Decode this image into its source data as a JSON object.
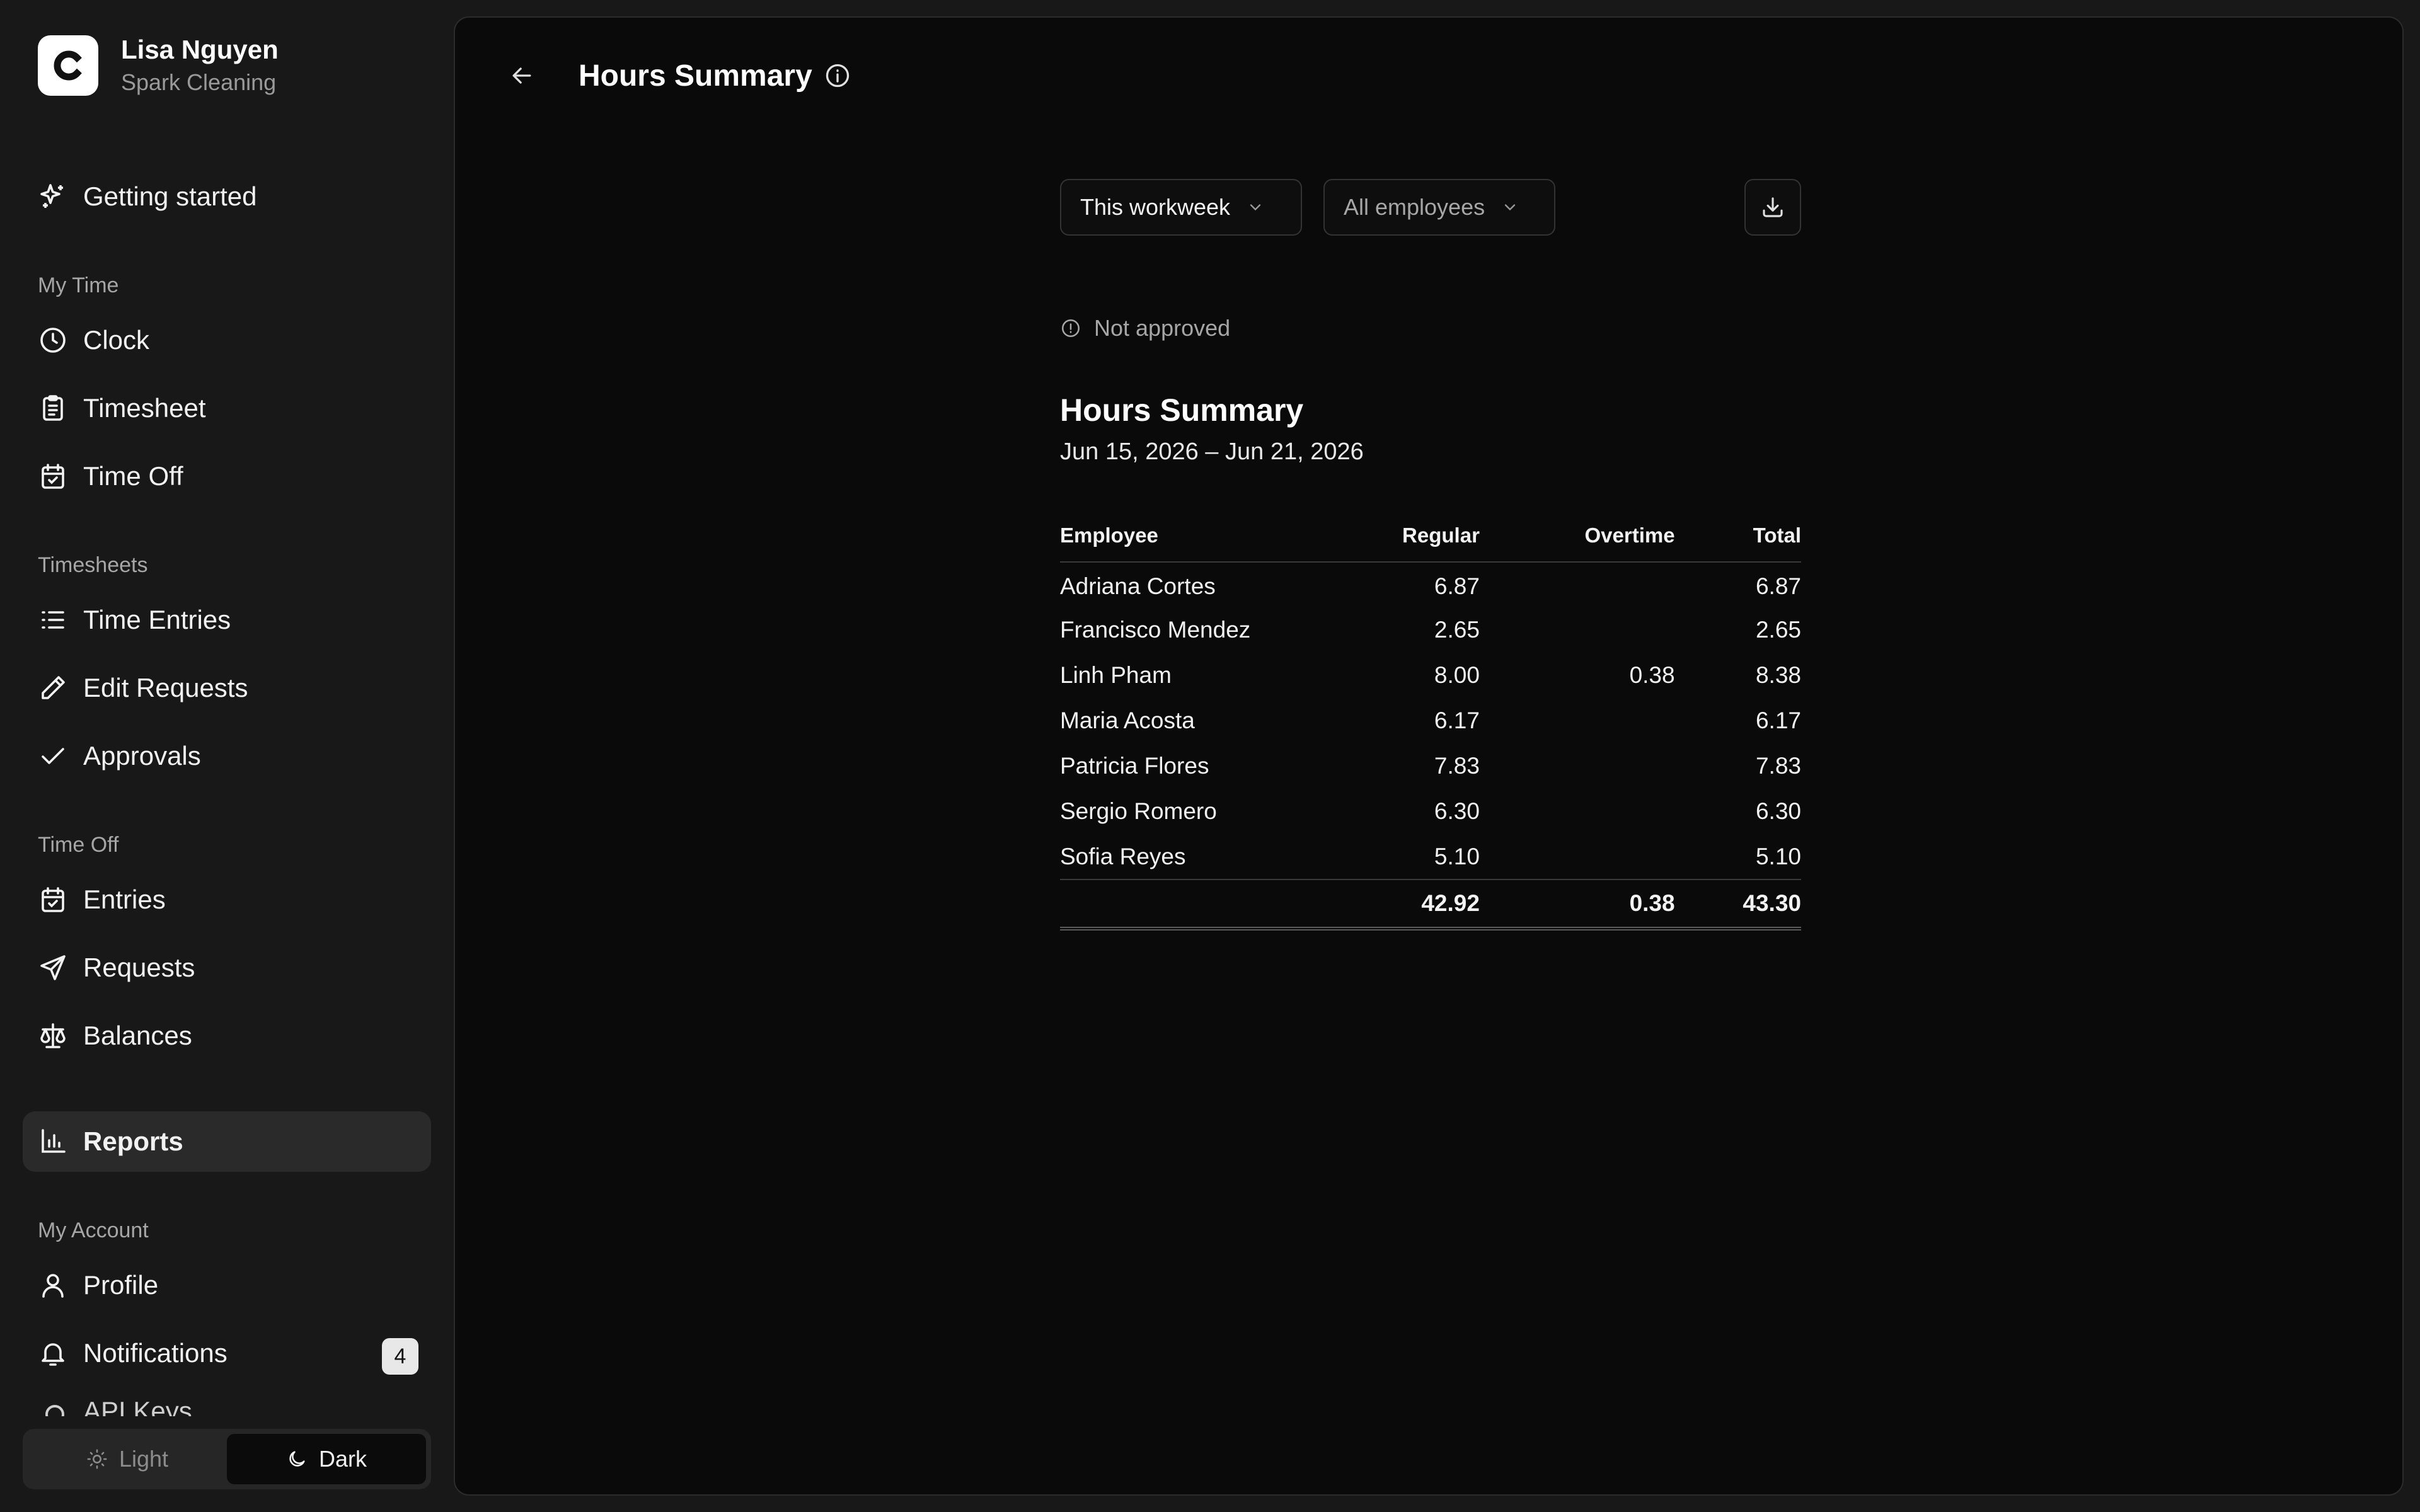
{
  "user": {
    "name": "Lisa Nguyen",
    "company": "Spark Cleaning",
    "logo_letter": "C"
  },
  "nav": {
    "getting_started": "Getting started",
    "my_time": {
      "label": "My Time",
      "items": [
        "Clock",
        "Timesheet",
        "Time Off"
      ]
    },
    "timesheets": {
      "label": "Timesheets",
      "items": [
        "Time Entries",
        "Edit Requests",
        "Approvals"
      ]
    },
    "time_off": {
      "label": "Time Off",
      "items": [
        "Entries",
        "Requests",
        "Balances"
      ]
    },
    "reports": "Reports",
    "my_account": {
      "label": "My Account",
      "items": [
        "Profile",
        "Notifications"
      ]
    },
    "notifications_count": "4",
    "clipped_item": "API Keys"
  },
  "theme": {
    "light": "Light",
    "dark": "Dark",
    "selected": "Dark"
  },
  "page": {
    "title": "Hours Summary"
  },
  "filters": {
    "period": "This workweek",
    "employees": "All employees"
  },
  "status": "Not approved",
  "report": {
    "title": "Hours Summary",
    "range": "Jun 15, 2026 – Jun 21, 2026",
    "columns": [
      "Employee",
      "Regular",
      "Overtime",
      "Total"
    ],
    "rows": [
      {
        "employee": "Adriana Cortes",
        "regular": "6.87",
        "overtime": "",
        "total": "6.87"
      },
      {
        "employee": "Francisco Mendez",
        "regular": "2.65",
        "overtime": "",
        "total": "2.65"
      },
      {
        "employee": "Linh Pham",
        "regular": "8.00",
        "overtime": "0.38",
        "total": "8.38"
      },
      {
        "employee": "Maria Acosta",
        "regular": "6.17",
        "overtime": "",
        "total": "6.17"
      },
      {
        "employee": "Patricia Flores",
        "regular": "7.83",
        "overtime": "",
        "total": "7.83"
      },
      {
        "employee": "Sergio Romero",
        "regular": "6.30",
        "overtime": "",
        "total": "6.30"
      },
      {
        "employee": "Sofia Reyes",
        "regular": "5.10",
        "overtime": "",
        "total": "5.10"
      }
    ],
    "totals": {
      "regular": "42.92",
      "overtime": "0.38",
      "total": "43.30"
    }
  },
  "colors": {
    "background": "#0a0a0a",
    "sidebar": "#181818",
    "active_item": "#2a2a2a",
    "text": "#f2f2f2",
    "muted": "#a6a6a6"
  }
}
